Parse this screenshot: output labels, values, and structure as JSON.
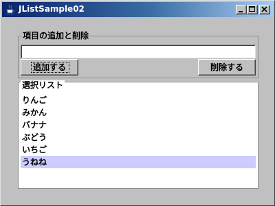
{
  "window": {
    "title": "JListSample02",
    "controls": [
      "minimize-icon",
      "maximize-icon",
      "close-icon"
    ]
  },
  "edit_group": {
    "label": "項目の追加と削除",
    "input_value": "",
    "add_button": "追加する",
    "delete_button": "削除する"
  },
  "list_group": {
    "label": "選択リスト",
    "items": [
      "りんご",
      "みかん",
      "バナナ",
      "ぶどう",
      "いちご",
      "うねね"
    ],
    "selected_index": 5
  },
  "colors": {
    "selection": "#ccccff",
    "titlebar_start": "#0a246a",
    "titlebar_end": "#a6caf0",
    "background": "#c0c0c0"
  }
}
